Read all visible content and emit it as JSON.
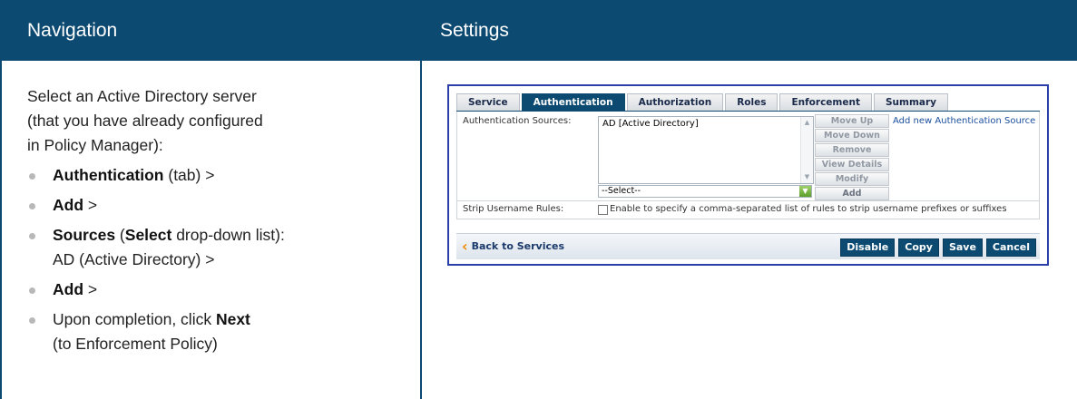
{
  "headers": {
    "navigation": "Navigation",
    "settings": "Settings"
  },
  "navigation": {
    "intro": [
      "Select an Active Directory server",
      "(that you have already configured",
      "in Policy Manager):"
    ],
    "steps": [
      {
        "bold": "Authentication",
        "text": " (tab) >"
      },
      {
        "bold": "Add",
        "text": " >"
      },
      {
        "bold": "Sources",
        "mid": " (",
        "bold2": "Select",
        "text": " drop-down list):",
        "line2": "AD (Active Directory) >"
      },
      {
        "bold": "Add",
        "text": " >"
      },
      {
        "pre": "Upon completion, click ",
        "bold": "Next",
        "line2": "(to Enforcement Policy)"
      }
    ]
  },
  "screen": {
    "tabs": [
      "Service",
      "Authentication",
      "Authorization",
      "Roles",
      "Enforcement",
      "Summary"
    ],
    "active_tab": "Authentication",
    "auth_sources_label": "Authentication Sources:",
    "auth_sources_list": [
      "AD [Active Directory]"
    ],
    "select_value": "--Select--",
    "side_buttons": [
      "Move Up",
      "Move Down",
      "Remove",
      "View Details",
      "Modify",
      "Add"
    ],
    "add_new_link": "Add new Authentication Source",
    "strip_label": "Strip Username Rules:",
    "strip_text": "Enable to specify a comma-separated list of rules to strip username prefixes or suffixes",
    "back_link": "Back to Services",
    "footer_buttons": [
      "Disable",
      "Copy",
      "Save",
      "Cancel"
    ],
    "accent_color": "#0c4a72"
  }
}
